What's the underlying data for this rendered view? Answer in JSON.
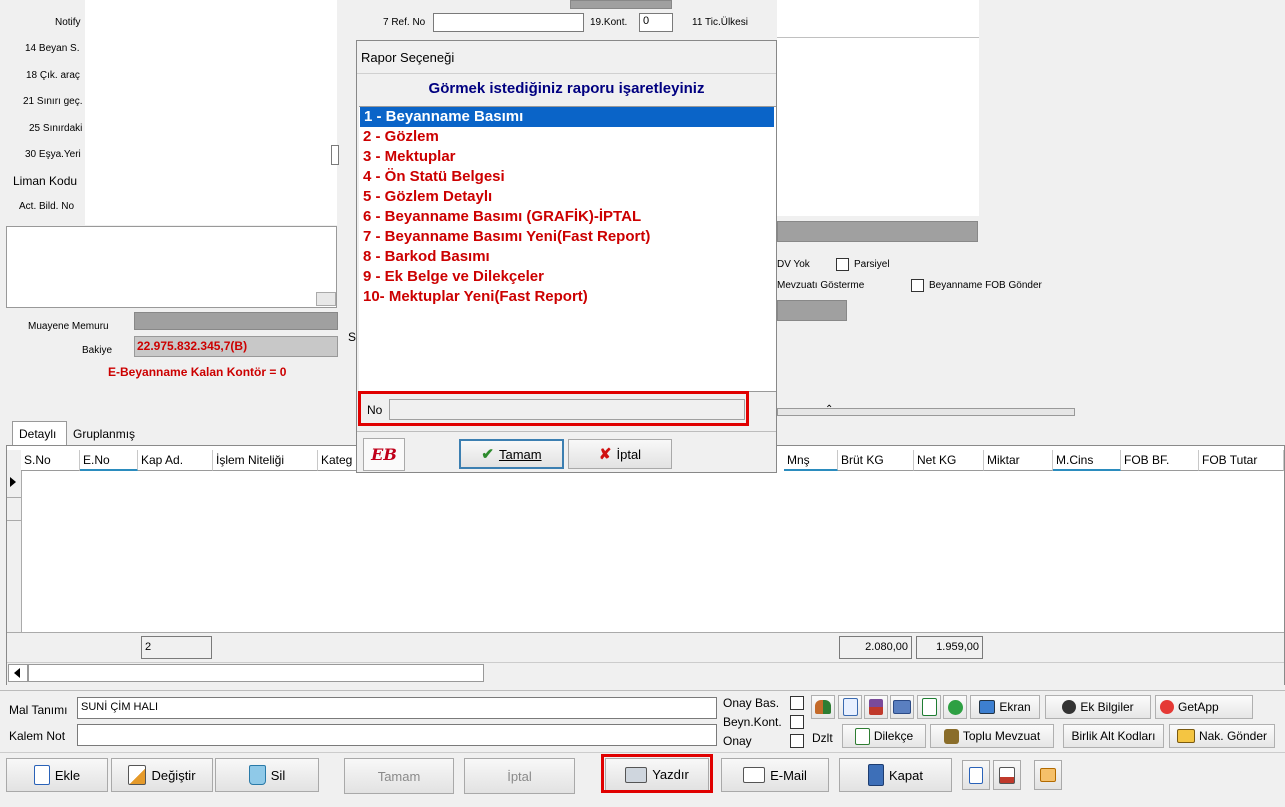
{
  "left_labels": {
    "notify": "Notify",
    "beyan": "14 Beyan S.",
    "cik": "18 Çık. araç",
    "sinir_gec": "21 Sınırı geç.",
    "sinirdaki": "25 Sınırdaki",
    "esya": "30 Eşya.Yeri",
    "liman": "Liman Kodu",
    "act": "Act. Bild. No",
    "muayene": "Muayene Memuru",
    "bakiye": "Bakiye"
  },
  "top_fields": {
    "ref_label": "7 Ref. No",
    "kont_label": "19.Kont.",
    "kont_value": "0",
    "tic_label": "11 Tic.Ülkesi",
    "s_label": "S"
  },
  "bakiye_value": "22.975.832.345,7(B)",
  "kontor_text": "E-Beyanname Kalan Kontör = 0",
  "right_opts": {
    "dv_yok": "DV Yok",
    "parsiyel": "Parsiyel",
    "mevzuat": "Mevzuatı Gösterme",
    "fob_gonder": "Beyanname FOB Gönder"
  },
  "tabs": [
    "Detaylı",
    "Gruplanmış"
  ],
  "grid": {
    "columns": [
      "S.No",
      "E.No",
      "Kap Ad.",
      "İşlem Niteliği",
      "Kateg",
      "Mnş",
      "Brüt KG",
      "Net KG",
      "Miktar",
      "M.Cins",
      "FOB BF.",
      "FOB Tutar"
    ],
    "footer_count": "2",
    "footer_brut": "2.080,00",
    "footer_net": "1.959,00"
  },
  "mal": {
    "tanim_label": "Mal Tanımı",
    "tanim_value": "SUNİ ÇİM HALI",
    "kalem_label": "Kalem Not",
    "onay_bas": "Onay Bas.",
    "beyn_kont": "Beyn.Kont.",
    "onay": "Onay",
    "dzlt": "Dzlt"
  },
  "tool_buttons": {
    "ekran": "Ekran",
    "ek_bilgiler": "Ek Bilgiler",
    "getapp": "GetApp",
    "dilekce": "Dilekçe",
    "toplu_mevzuat": "Toplu Mevzuat",
    "birlik": "Birlik Alt Kodları",
    "nak_gonder": "Nak. Gönder"
  },
  "bottom_buttons": {
    "ekle": "Ekle",
    "degistir": "Değiştir",
    "sil": "Sil",
    "tamam": "Tamam",
    "iptal": "İptal",
    "yazdir": "Yazdır",
    "email": "E-Mail",
    "kapat": "Kapat"
  },
  "dialog": {
    "title": "Rapor Seçeneği",
    "heading": "Görmek istediğiniz raporu işaretleyiniz",
    "items": [
      "1 - Beyanname Basımı",
      "2 - Gözlem",
      "3 - Mektuplar",
      "4 - Ön Statü Belgesi",
      "5 - Gözlem Detaylı",
      "6 - Beyanname Basımı (GRAFİK)-İPTAL",
      "7 - Beyanname Basımı Yeni(Fast Report)",
      "8 - Barkod    Basımı",
      "9 - Ek Belge ve Dilekçeler",
      "10- Mektuplar Yeni(Fast Report)"
    ],
    "selected_index": 0,
    "no_label": "No",
    "no_value": "",
    "ok_label": "Tamam",
    "cancel_label": "İptal",
    "logo_text": "EB"
  },
  "colors": {
    "selection": "#0a64c8",
    "item_red": "#cc0000",
    "heading_blue": "#000080",
    "highlight_box": "#e00000"
  }
}
